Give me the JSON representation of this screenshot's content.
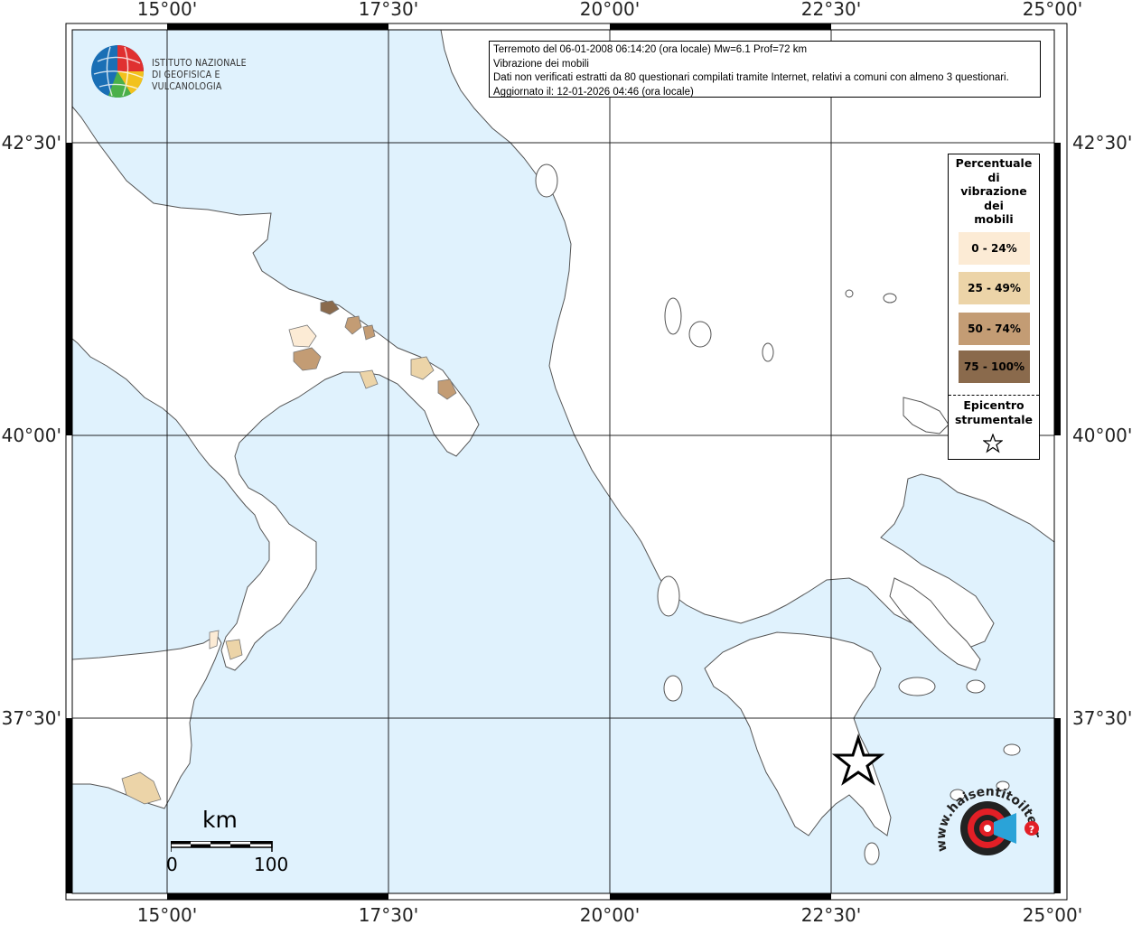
{
  "coordinates": {
    "lon_top": [
      "15°00'",
      "17°30'",
      "20°00'",
      "22°30'",
      "25°00'"
    ],
    "lon_bottom": [
      "15°00'",
      "17°30'",
      "20°00'",
      "22°30'",
      "25°00'"
    ],
    "lat_left": [
      "42°30'",
      "40°00'",
      "37°30'"
    ],
    "lat_right": [
      "42°30'",
      "40°00'",
      "37°30'"
    ]
  },
  "info": {
    "line1": "Terremoto del 06-01-2008 06:14:20 (ora locale) Mw=6.1 Prof=72 km",
    "line2": "Vibrazione dei mobili",
    "line3": "Dati non verificati estratti da 80 questionari compilati tramite Internet, relativi a comuni con almeno 3 questionari.",
    "line4": "Aggiornato il: 12-01-2026 04:46 (ora locale)"
  },
  "logo": {
    "line1": "ISTITUTO NAZIONALE",
    "line2": "DI GEOFISICA E VULCANOLOGIA"
  },
  "legend": {
    "title_lines": [
      "Percentuale",
      "di",
      "vibrazione",
      "dei",
      "mobili"
    ],
    "items": [
      {
        "label": "0 - 24%",
        "color": "#fcebd5"
      },
      {
        "label": "25 - 49%",
        "color": "#ecd4a8"
      },
      {
        "label": "50 - 74%",
        "color": "#c39c74"
      },
      {
        "label": "75 - 100%",
        "color": "#8a6a4c"
      }
    ],
    "epicenter_lines": [
      "Epicentro",
      "strumentale"
    ]
  },
  "scalebar": {
    "unit": "km",
    "start": "0",
    "end": "100"
  },
  "brand": {
    "text": "www.haisentitoilterremoto.it"
  },
  "colors": {
    "sea": "#e0f2fd",
    "land": "#ffffff",
    "grid": "#000000"
  }
}
